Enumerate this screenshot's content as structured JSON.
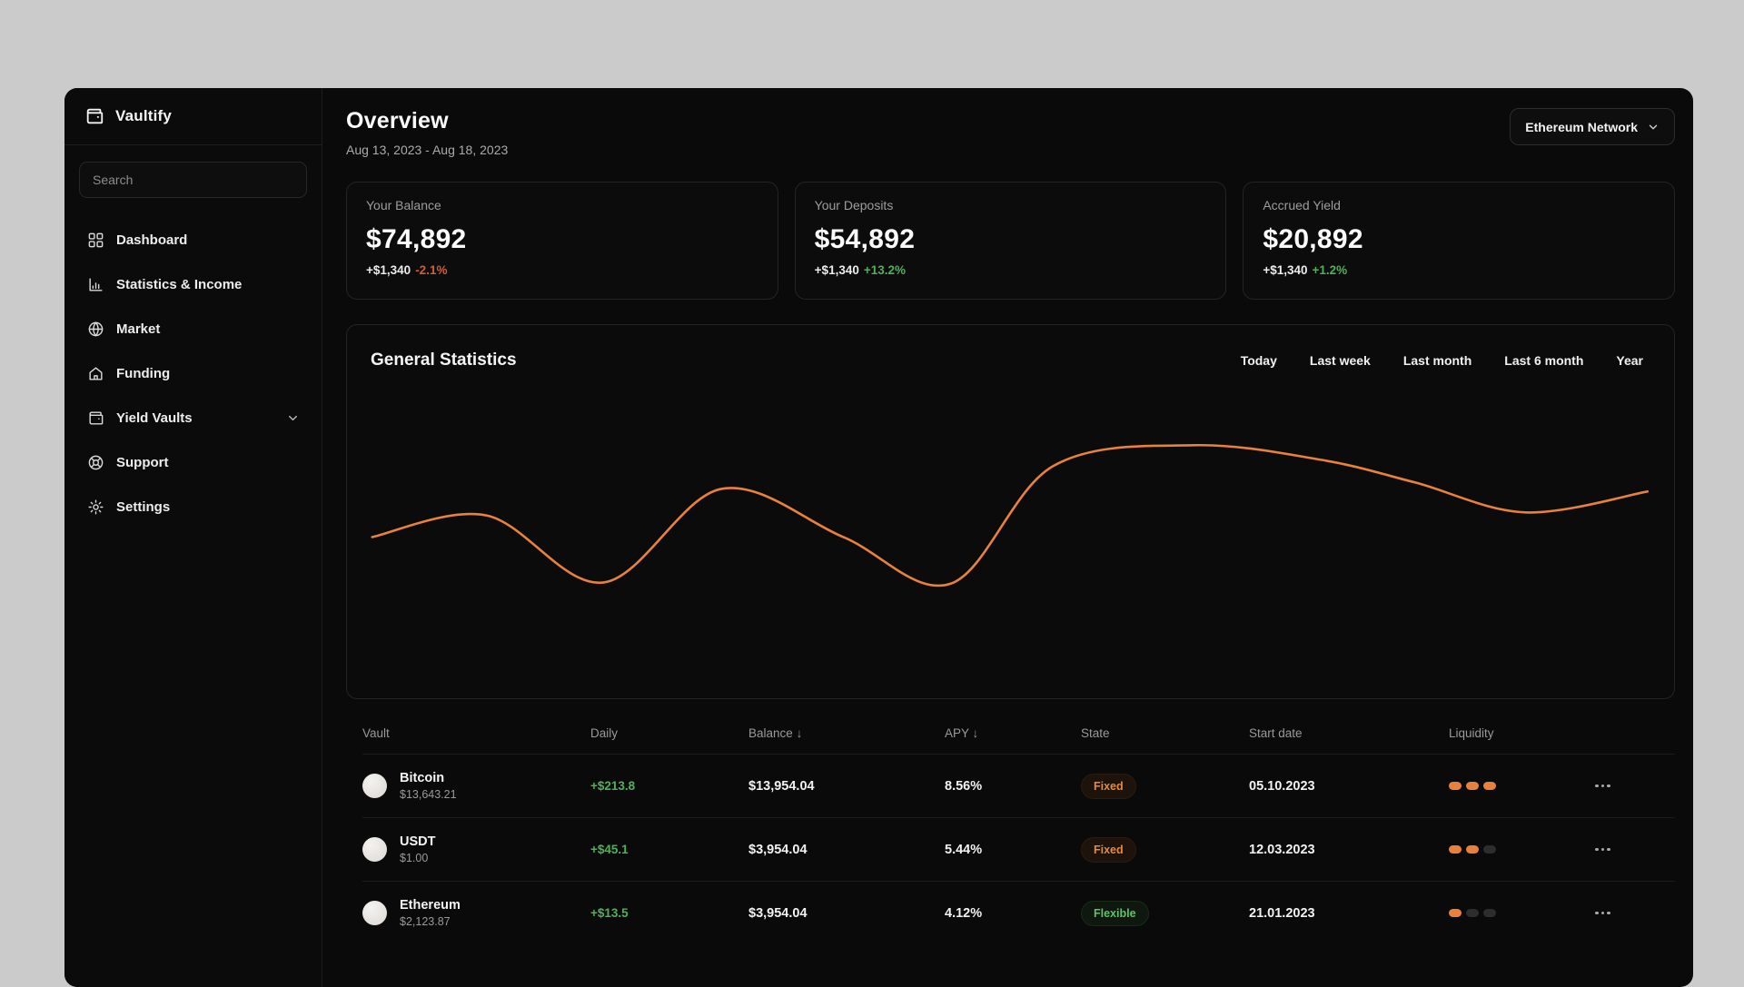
{
  "app": {
    "name": "Vaultify"
  },
  "sidebar": {
    "search_placeholder": "Search",
    "items": [
      {
        "label": "Dashboard",
        "icon": "dashboard-grid-icon",
        "expandable": false
      },
      {
        "label": "Statistics & Income",
        "icon": "bar-chart-icon",
        "expandable": false
      },
      {
        "label": "Market",
        "icon": "globe-icon",
        "expandable": false
      },
      {
        "label": "Funding",
        "icon": "home-icon",
        "expandable": false
      },
      {
        "label": "Yield Vaults",
        "icon": "wallet-icon",
        "expandable": true
      },
      {
        "label": "Support",
        "icon": "lifebuoy-icon",
        "expandable": false
      },
      {
        "label": "Settings",
        "icon": "gear-icon",
        "expandable": false
      }
    ]
  },
  "header": {
    "title": "Overview",
    "date_range": "Aug 13, 2023 - Aug 18, 2023",
    "network_selector": "Ethereum Network",
    "network_selector_icon": "chevron-down-icon"
  },
  "stats_cards": [
    {
      "label": "Your Balance",
      "value": "$74,892",
      "delta": "+$1,340",
      "percent": "-2.1%",
      "percent_color": "#cf5f32"
    },
    {
      "label": "Your Deposits",
      "value": "$54,892",
      "delta": "+$1,340",
      "percent": "+13.2%",
      "percent_color": "#4fb157"
    },
    {
      "label": "Accrued Yield",
      "value": "$20,892",
      "delta": "+$1,340",
      "percent": "+1.2%",
      "percent_color": "#4fb157"
    }
  ],
  "statistics_panel": {
    "title": "General Statistics",
    "filters": [
      "Today",
      "Last week",
      "Last month",
      "Last 6 month",
      "Year"
    ]
  },
  "chart_data": {
    "type": "line",
    "title": "General Statistics",
    "xlabel": "",
    "ylabel": "",
    "grid": false,
    "axes_visible": false,
    "legend_position": "none",
    "ylim": [
      0,
      100
    ],
    "series": [
      {
        "name": "portfolio-value",
        "color": "#e8813c",
        "x_pct": [
          1.9,
          10.5,
          19.3,
          28.2,
          37.4,
          45.5,
          53.2,
          63.8,
          73.4,
          80.5,
          88.8,
          98.0
        ],
        "values": [
          43.2,
          49.0,
          31.0,
          56.1,
          43.2,
          30.7,
          62.2,
          67.8,
          63.9,
          57.8,
          49.8,
          55.4
        ]
      }
    ]
  },
  "table": {
    "columns": [
      {
        "label": "Vault",
        "sort_icon": ""
      },
      {
        "label": "Daily",
        "sort_icon": ""
      },
      {
        "label": "Balance",
        "sort_icon": "↓"
      },
      {
        "label": "APY",
        "sort_icon": "↓"
      },
      {
        "label": "State",
        "sort_icon": ""
      },
      {
        "label": "Start date",
        "sort_icon": ""
      },
      {
        "label": "Liquidity",
        "sort_icon": ""
      }
    ],
    "rows": [
      {
        "name": "Bitcoin",
        "price": "$13,643.21",
        "daily": "+$213.8",
        "balance": "$13,954.04",
        "apy": "8.56%",
        "state": "Fixed",
        "start_date": "05.10.2023",
        "liquidity_filled": 3,
        "liquidity_total": 3
      },
      {
        "name": "USDT",
        "price": "$1.00",
        "daily": "+$45.1",
        "balance": "$3,954.04",
        "apy": "5.44%",
        "state": "Fixed",
        "start_date": "12.03.2023",
        "liquidity_filled": 2,
        "liquidity_total": 3
      },
      {
        "name": "Ethereum",
        "price": "$2,123.87",
        "daily": "+$13.5",
        "balance": "$3,954.04",
        "apy": "4.12%",
        "state": "Flexible",
        "start_date": "21.01.2023",
        "liquidity_filled": 1,
        "liquidity_total": 3
      }
    ],
    "row_actions_icon": "ellipsis-icon"
  },
  "colors": {
    "accent_orange": "#e8813c",
    "positive_green": "#4fb157",
    "negative_orange": "#cf5f32",
    "badge_fixed": "#e8883f",
    "badge_flexible": "#5ec364",
    "liquidity_inactive": "#2d2d2d"
  }
}
